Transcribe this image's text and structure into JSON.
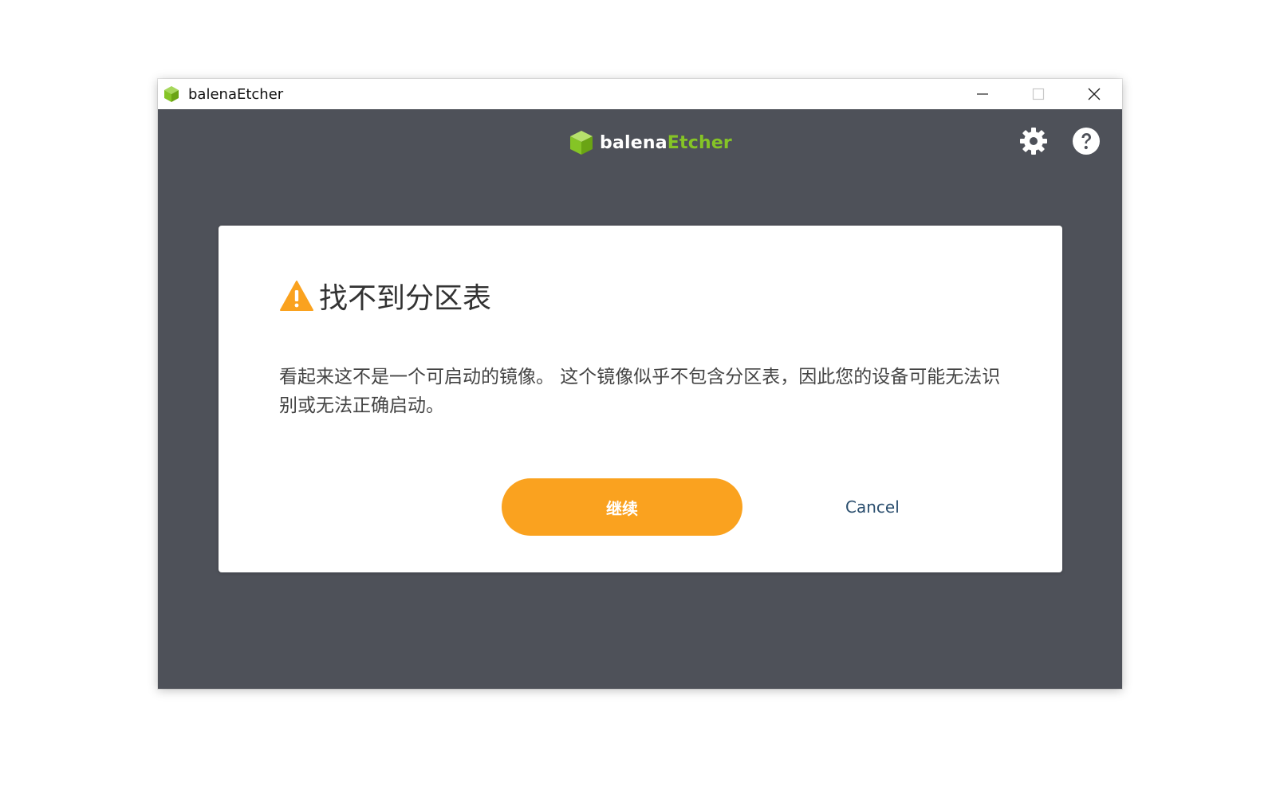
{
  "window": {
    "title": "balenaEtcher",
    "controls": {
      "minimize": "minimize-icon",
      "maximize": "maximize-icon",
      "close": "close-icon"
    }
  },
  "header": {
    "brand_primary": "balena",
    "brand_secondary": "Etcher",
    "logo_icon": "etcher-cube-logo",
    "settings_icon": "gear-icon",
    "help_icon": "help-icon"
  },
  "dialog": {
    "title": "找不到分区表",
    "message": "看起来这不是一个可启动的镜像。 这个镜像似乎不包含分区表，因此您的设备可能无法识别或无法正确启动。",
    "continue_label": "继续",
    "cancel_label": "Cancel"
  },
  "colors": {
    "background": "#4e5159",
    "accent": "#faa21f",
    "brand_green": "#85c426",
    "link": "#2a4e6e"
  }
}
